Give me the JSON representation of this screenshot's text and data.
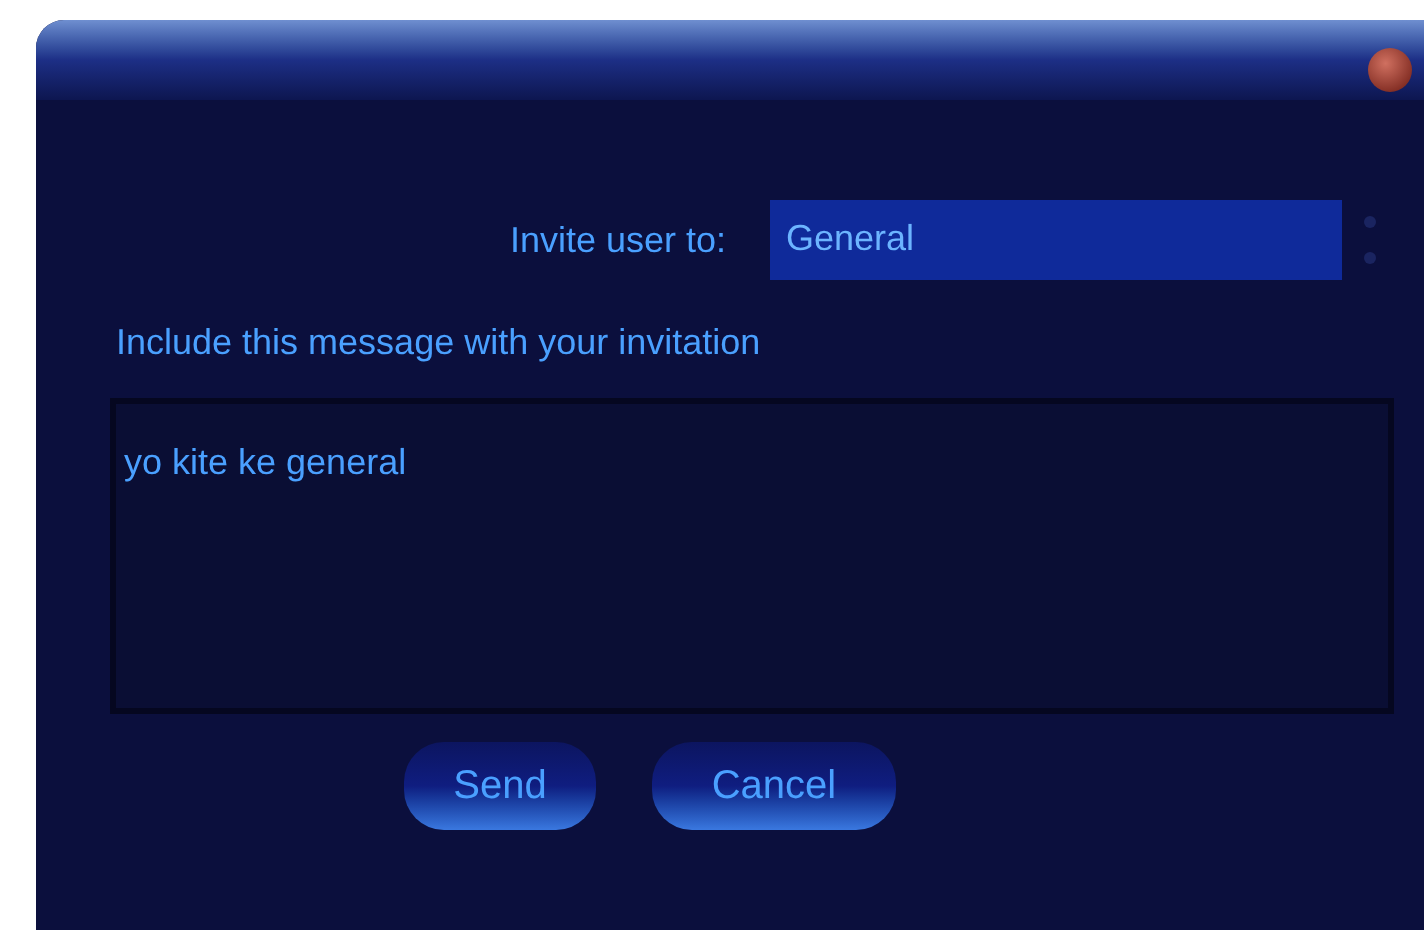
{
  "invite": {
    "label": "Invite user to:",
    "value": "General"
  },
  "message": {
    "label": "Include this message with your invitation",
    "value": "yo kite ke general"
  },
  "buttons": [
    "Send",
    "Cancel"
  ]
}
